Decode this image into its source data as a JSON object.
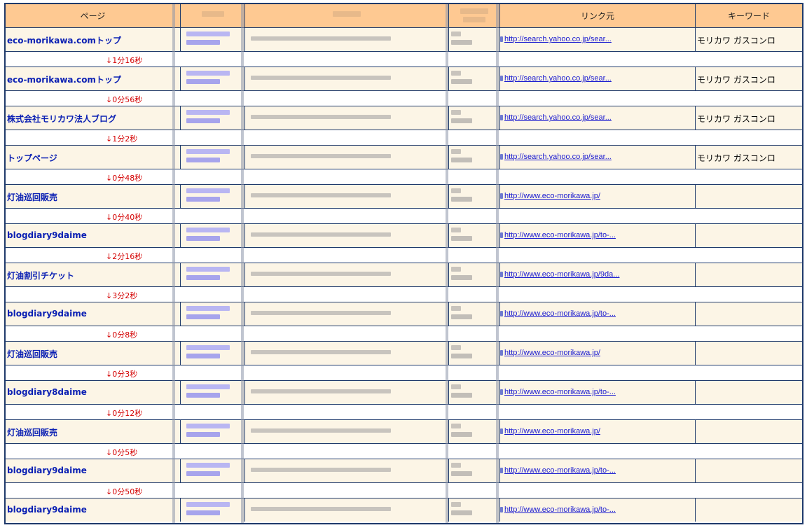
{
  "columns": {
    "page": "ページ",
    "ip": "",
    "host": "",
    "browser": "",
    "referrer": "リンク元",
    "keyword": "キーワード"
  },
  "visits": [
    {
      "page": "eco-morikawa.comトップ",
      "referrer": "http://search.yahoo.co.jp/sear...",
      "keyword": "モリカワ ガスコンロ",
      "elapsed": "↓1分16秒"
    },
    {
      "page": "eco-morikawa.comトップ",
      "referrer": "http://search.yahoo.co.jp/sear...",
      "keyword": "モリカワ ガスコンロ",
      "elapsed": "↓0分56秒"
    },
    {
      "page": "株式会社モリカワ法人ブログ",
      "referrer": "http://search.yahoo.co.jp/sear...",
      "keyword": "モリカワ ガスコンロ",
      "elapsed": "↓1分2秒"
    },
    {
      "page": "トップページ",
      "referrer": "http://search.yahoo.co.jp/sear...",
      "keyword": "モリカワ ガスコンロ",
      "elapsed": "↓0分48秒"
    },
    {
      "page": "灯油巡回販売",
      "referrer": "http://www.eco-morikawa.jp/",
      "keyword": "",
      "elapsed": "↓0分40秒"
    },
    {
      "page": "blogdiary9daime",
      "referrer": "http://www.eco-morikawa.jp/to-...",
      "keyword": "",
      "elapsed": "↓2分16秒"
    },
    {
      "page": "灯油割引チケット",
      "referrer": "http://www.eco-morikawa.jp/9da...",
      "keyword": "",
      "elapsed": "↓3分2秒"
    },
    {
      "page": "blogdiary9daime",
      "referrer": "http://www.eco-morikawa.jp/to-...",
      "keyword": "",
      "elapsed": "↓0分8秒"
    },
    {
      "page": "灯油巡回販売",
      "referrer": "http://www.eco-morikawa.jp/",
      "keyword": "",
      "elapsed": "↓0分3秒"
    },
    {
      "page": "blogdiary8daime",
      "referrer": "http://www.eco-morikawa.jp/to-...",
      "keyword": "",
      "elapsed": "↓0分12秒"
    },
    {
      "page": "灯油巡回販売",
      "referrer": "http://www.eco-morikawa.jp/",
      "keyword": "",
      "elapsed": "↓0分5秒"
    },
    {
      "page": "blogdiary9daime",
      "referrer": "http://www.eco-morikawa.jp/to-...",
      "keyword": "",
      "elapsed": "↓0分50秒"
    },
    {
      "page": "blogdiary9daime",
      "referrer": "http://www.eco-morikawa.jp/to-...",
      "keyword": "",
      "elapsed": ""
    }
  ]
}
